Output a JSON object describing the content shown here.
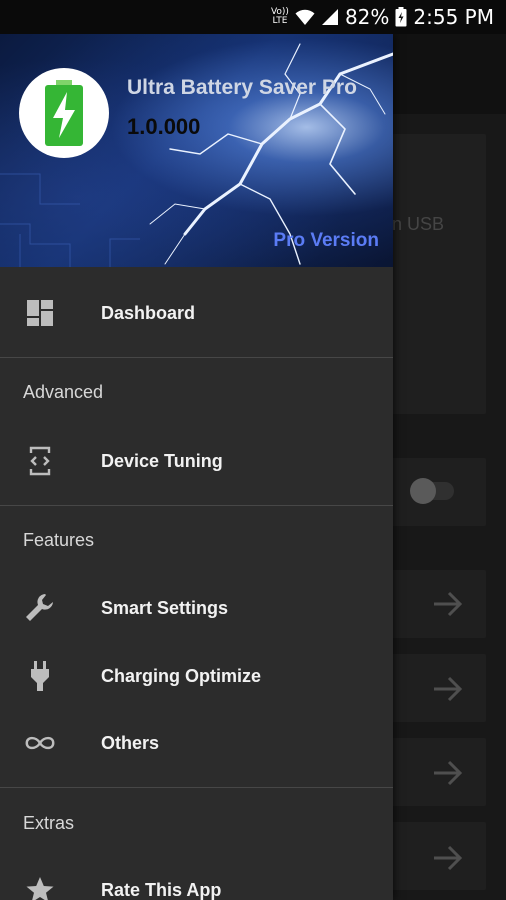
{
  "status_bar": {
    "volte_top": "Vo))",
    "volte_bottom": "LTE",
    "battery": "82%",
    "time": "2:55 PM"
  },
  "background": {
    "usb_text": "n USB"
  },
  "drawer": {
    "header": {
      "app_name": "Ultra Battery Saver Pro",
      "version": "1.0.000",
      "pro_label": "Pro Version",
      "pro_color": "#5b7cf5",
      "logo_icon": "battery-charging-icon"
    },
    "items": [
      {
        "label": "Dashboard",
        "icon": "dashboard-icon"
      },
      {
        "label": "Device Tuning",
        "icon": "device-code-icon"
      },
      {
        "label": "Smart Settings",
        "icon": "wrench-icon"
      },
      {
        "label": "Charging Optimize",
        "icon": "plug-icon"
      },
      {
        "label": "Others",
        "icon": "infinity-icon"
      },
      {
        "label": "Rate This App",
        "icon": "star-icon"
      }
    ],
    "sections": {
      "advanced": "Advanced",
      "features": "Features",
      "extras": "Extras"
    }
  }
}
